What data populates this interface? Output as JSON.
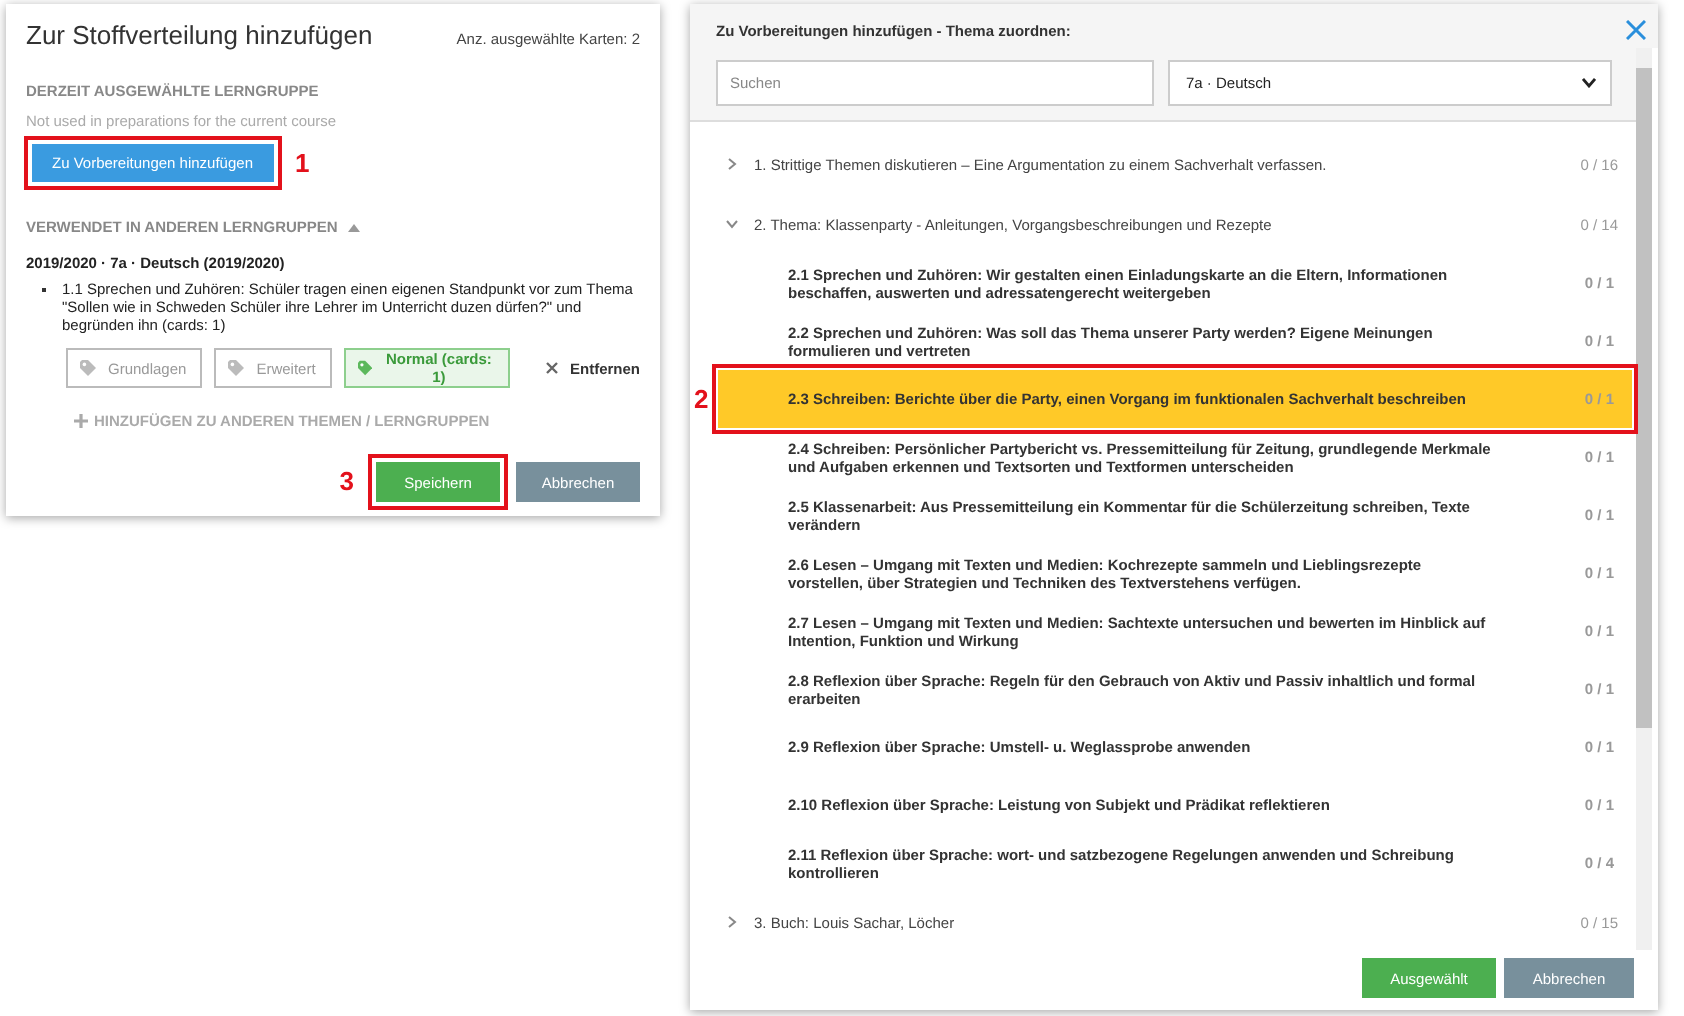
{
  "left_dialog": {
    "title": "Zur Stoffverteilung hinzufügen",
    "selected_count": "Anz. ausgewählte Karten: 2",
    "current_group": {
      "heading": "DERZEIT AUSGEWÄHLTE LERNGRUPPE",
      "note": "Not used in preparations for the current course",
      "button": {
        "label": "Zu Vorbereitungen hinzufügen",
        "annotation": "1"
      }
    },
    "other_groups": {
      "heading": "VERWENDET IN ANDEREN LERNGRUPPEN",
      "expanded": true,
      "group_title": "2019/2020 · 7a · Deutsch (2019/2020)",
      "entry": "1.1 Sprechen und Zuhören: Schüler tragen einen eigenen Standpunkt vor zum Thema \"Sollen wie in Schweden Schüler ihre Lehrer im Unterricht duzen dürfen?\" und begründen ihn (cards: 1)",
      "levels": [
        {
          "label": "Grundlagen",
          "selected": false
        },
        {
          "label": "Erweitert",
          "selected": false
        },
        {
          "label": "Normal (cards: 1)",
          "selected": true
        }
      ],
      "remove_label": "Entfernen",
      "add_link": "HINZUFÜGEN ZU ANDEREN THEMEN / LERNGRUPPEN"
    },
    "buttons": [
      {
        "label": "Speichern",
        "kind": "primary",
        "annotation": "3"
      },
      {
        "label": "Abbrechen",
        "kind": "secondary"
      }
    ]
  },
  "right_dialog": {
    "title": "Zu Vorbereitungen hinzufügen - Thema zuordnen:",
    "search": {
      "placeholder": "Suchen"
    },
    "course_select": {
      "value": "7a · Deutsch"
    },
    "topics": [
      {
        "label": "1. Strittige Themen diskutieren – Eine Argumentation zu einem Sachverhalt verfassen.",
        "count": "0 / 16",
        "expanded": false
      },
      {
        "label": "2. Thema: Klassenparty - Anleitungen, Vorgangsbeschreibungen und Rezepte",
        "count": "0 / 14",
        "expanded": true,
        "children": [
          {
            "label": "2.1  Sprechen und Zuhören: Wir gestalten einen Einladungskarte an die Eltern, Informationen beschaffen, auswerten und adressatengerecht weitergeben",
            "count": "0 / 1",
            "selected": false
          },
          {
            "label": "2.2  Sprechen und Zuhören: Was soll das Thema unserer Party werden? Eigene Meinungen formulieren und vertreten",
            "count": "0 / 1",
            "selected": false
          },
          {
            "label": "2.3  Schreiben: Berichte über die Party, einen Vorgang im funktionalen Sachverhalt beschreiben",
            "count": "0 / 1",
            "selected": true,
            "annotation": "2"
          },
          {
            "label": "2.4  Schreiben: Persönlicher Partybericht vs. Pressemitteilung für Zeitung, grundlegende Merkmale und Aufgaben erkennen und Textsorten und Textformen unterscheiden",
            "count": "0 / 1",
            "selected": false
          },
          {
            "label": "2.5  Klassenarbeit: Aus Pressemitteilung ein Kommentar für die Schülerzeitung schreiben, Texte verändern",
            "count": "0 / 1",
            "selected": false
          },
          {
            "label": "2.6  Lesen – Umgang mit Texten und Medien: Kochrezepte sammeln und Lieblingsrezepte vorstellen, über Strategien und Techniken des Textverstehens verfügen.",
            "count": "0 / 1",
            "selected": false
          },
          {
            "label": "2.7  Lesen – Umgang mit Texten und Medien: Sachtexte untersuchen und bewerten im Hinblick auf Intention, Funktion und Wirkung",
            "count": "0 / 1",
            "selected": false
          },
          {
            "label": "2.8  Reflexion über Sprache: Regeln für den Gebrauch von Aktiv und Passiv inhaltlich und formal erarbeiten",
            "count": "0 / 1",
            "selected": false
          },
          {
            "label": "2.9  Reflexion über Sprache: Umstell- u. Weglassprobe anwenden",
            "count": "0 / 1",
            "selected": false
          },
          {
            "label": "2.10  Reflexion über Sprache: Leistung von Subjekt und Prädikat reflektieren",
            "count": "0 / 1",
            "selected": false
          },
          {
            "label": "2.11  Reflexion über Sprache: wort- und satzbezogene Regelungen anwenden und Schreibung kontrollieren",
            "count": "0 / 4",
            "selected": false
          }
        ]
      },
      {
        "label": "3. Buch: Louis Sachar, Löcher",
        "count": "0 / 15",
        "expanded": false
      }
    ],
    "buttons": [
      {
        "label": "Ausgewählt",
        "kind": "primary"
      },
      {
        "label": "Abbrechen",
        "kind": "secondary"
      }
    ]
  }
}
